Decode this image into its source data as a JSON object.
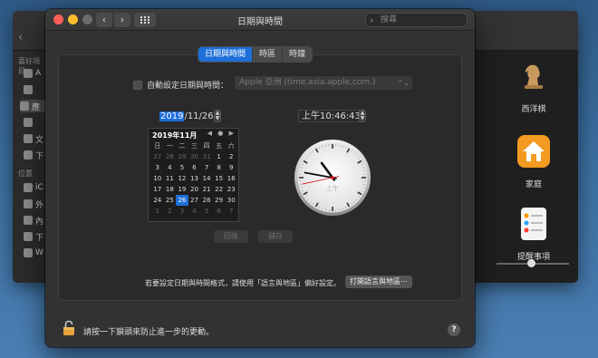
{
  "finder": {
    "sidebar_favorites": "喜好項目",
    "sidebar_locations": "位置",
    "sidebar_items": [
      "A",
      "",
      "應",
      "",
      "文",
      "下",
      "iC",
      "外",
      "內",
      "下",
      "W"
    ],
    "apps": [
      {
        "name": "西洋棋",
        "icon": "chess-icon"
      },
      {
        "name": "家庭",
        "icon": "home-icon"
      },
      {
        "name": "提醒事項",
        "icon": "reminders-icon"
      }
    ]
  },
  "window": {
    "title": "日期與時間",
    "search_placeholder": "搜尋"
  },
  "tabs": [
    {
      "label": "日期與時間",
      "active": true
    },
    {
      "label": "時區",
      "active": false
    },
    {
      "label": "時鐘",
      "active": false
    }
  ],
  "auto_set": {
    "label": "自動設定日期與時間：",
    "checked": false,
    "server": "Apple 亞洲 (time.asia.apple.com.)"
  },
  "date": {
    "year": "2019",
    "rest": "/11/26"
  },
  "time": {
    "value": "上午10:46:43"
  },
  "calendar": {
    "header": "2019年11月",
    "nav": "◀ ● ▶",
    "weekdays": [
      "日",
      "一",
      "二",
      "三",
      "四",
      "五",
      "六"
    ],
    "days": [
      {
        "d": "27",
        "cur": false
      },
      {
        "d": "28",
        "cur": false
      },
      {
        "d": "29",
        "cur": false
      },
      {
        "d": "30",
        "cur": false
      },
      {
        "d": "31",
        "cur": false
      },
      {
        "d": "1",
        "cur": true
      },
      {
        "d": "2",
        "cur": true
      },
      {
        "d": "3",
        "cur": true
      },
      {
        "d": "4",
        "cur": true
      },
      {
        "d": "5",
        "cur": true
      },
      {
        "d": "6",
        "cur": true
      },
      {
        "d": "7",
        "cur": true
      },
      {
        "d": "8",
        "cur": true
      },
      {
        "d": "9",
        "cur": true
      },
      {
        "d": "10",
        "cur": true
      },
      {
        "d": "11",
        "cur": true
      },
      {
        "d": "12",
        "cur": true
      },
      {
        "d": "13",
        "cur": true
      },
      {
        "d": "14",
        "cur": true
      },
      {
        "d": "15",
        "cur": true
      },
      {
        "d": "16",
        "cur": true
      },
      {
        "d": "17",
        "cur": true
      },
      {
        "d": "18",
        "cur": true
      },
      {
        "d": "19",
        "cur": true
      },
      {
        "d": "20",
        "cur": true
      },
      {
        "d": "21",
        "cur": true
      },
      {
        "d": "22",
        "cur": true
      },
      {
        "d": "23",
        "cur": true
      },
      {
        "d": "24",
        "cur": true
      },
      {
        "d": "25",
        "cur": true
      },
      {
        "d": "26",
        "cur": true,
        "selected": true
      },
      {
        "d": "27",
        "cur": true
      },
      {
        "d": "28",
        "cur": true
      },
      {
        "d": "29",
        "cur": true
      },
      {
        "d": "30",
        "cur": true
      },
      {
        "d": "1",
        "cur": false
      },
      {
        "d": "2",
        "cur": false
      },
      {
        "d": "3",
        "cur": false
      },
      {
        "d": "4",
        "cur": false
      },
      {
        "d": "5",
        "cur": false
      },
      {
        "d": "6",
        "cur": false
      },
      {
        "d": "7",
        "cur": false
      }
    ]
  },
  "clock": {
    "ampm": "上午",
    "hour": 10,
    "minute": 46,
    "second": 43
  },
  "buttons": {
    "revert": "回復",
    "save": "儲存"
  },
  "format": {
    "text": "若要設定日期與時間格式，請使用「語言與地區」偏好設定。",
    "open_button": "打開語言與地區⋯"
  },
  "footer": {
    "lock_text": "請按一下鎖頭來防止進一步的更動。",
    "help": "?"
  },
  "colors": {
    "accent": "#1e6fd9",
    "window_bg": "#323232",
    "desktop": "#3b6e9e"
  }
}
